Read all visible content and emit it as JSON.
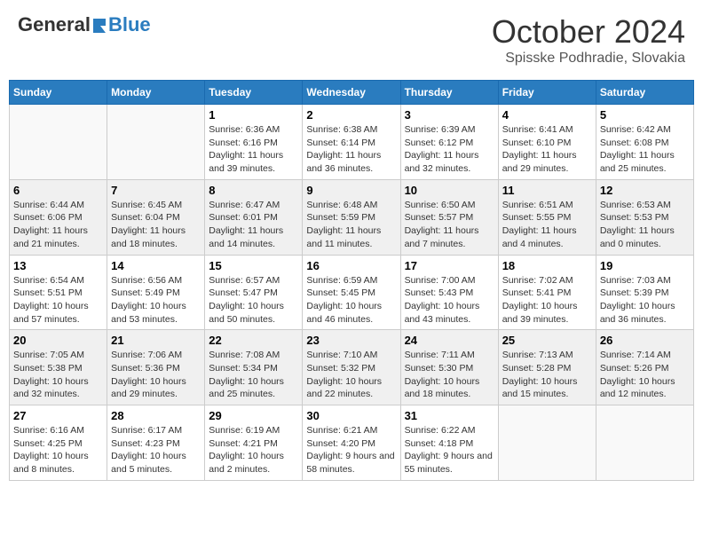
{
  "header": {
    "logo_general": "General",
    "logo_blue": "Blue",
    "month_title": "October 2024",
    "location": "Spisske Podhradie, Slovakia"
  },
  "weekdays": [
    "Sunday",
    "Monday",
    "Tuesday",
    "Wednesday",
    "Thursday",
    "Friday",
    "Saturday"
  ],
  "weeks": [
    [
      {
        "day": "",
        "info": ""
      },
      {
        "day": "",
        "info": ""
      },
      {
        "day": "1",
        "info": "Sunrise: 6:36 AM\nSunset: 6:16 PM\nDaylight: 11 hours and 39 minutes."
      },
      {
        "day": "2",
        "info": "Sunrise: 6:38 AM\nSunset: 6:14 PM\nDaylight: 11 hours and 36 minutes."
      },
      {
        "day": "3",
        "info": "Sunrise: 6:39 AM\nSunset: 6:12 PM\nDaylight: 11 hours and 32 minutes."
      },
      {
        "day": "4",
        "info": "Sunrise: 6:41 AM\nSunset: 6:10 PM\nDaylight: 11 hours and 29 minutes."
      },
      {
        "day": "5",
        "info": "Sunrise: 6:42 AM\nSunset: 6:08 PM\nDaylight: 11 hours and 25 minutes."
      }
    ],
    [
      {
        "day": "6",
        "info": "Sunrise: 6:44 AM\nSunset: 6:06 PM\nDaylight: 11 hours and 21 minutes."
      },
      {
        "day": "7",
        "info": "Sunrise: 6:45 AM\nSunset: 6:04 PM\nDaylight: 11 hours and 18 minutes."
      },
      {
        "day": "8",
        "info": "Sunrise: 6:47 AM\nSunset: 6:01 PM\nDaylight: 11 hours and 14 minutes."
      },
      {
        "day": "9",
        "info": "Sunrise: 6:48 AM\nSunset: 5:59 PM\nDaylight: 11 hours and 11 minutes."
      },
      {
        "day": "10",
        "info": "Sunrise: 6:50 AM\nSunset: 5:57 PM\nDaylight: 11 hours and 7 minutes."
      },
      {
        "day": "11",
        "info": "Sunrise: 6:51 AM\nSunset: 5:55 PM\nDaylight: 11 hours and 4 minutes."
      },
      {
        "day": "12",
        "info": "Sunrise: 6:53 AM\nSunset: 5:53 PM\nDaylight: 11 hours and 0 minutes."
      }
    ],
    [
      {
        "day": "13",
        "info": "Sunrise: 6:54 AM\nSunset: 5:51 PM\nDaylight: 10 hours and 57 minutes."
      },
      {
        "day": "14",
        "info": "Sunrise: 6:56 AM\nSunset: 5:49 PM\nDaylight: 10 hours and 53 minutes."
      },
      {
        "day": "15",
        "info": "Sunrise: 6:57 AM\nSunset: 5:47 PM\nDaylight: 10 hours and 50 minutes."
      },
      {
        "day": "16",
        "info": "Sunrise: 6:59 AM\nSunset: 5:45 PM\nDaylight: 10 hours and 46 minutes."
      },
      {
        "day": "17",
        "info": "Sunrise: 7:00 AM\nSunset: 5:43 PM\nDaylight: 10 hours and 43 minutes."
      },
      {
        "day": "18",
        "info": "Sunrise: 7:02 AM\nSunset: 5:41 PM\nDaylight: 10 hours and 39 minutes."
      },
      {
        "day": "19",
        "info": "Sunrise: 7:03 AM\nSunset: 5:39 PM\nDaylight: 10 hours and 36 minutes."
      }
    ],
    [
      {
        "day": "20",
        "info": "Sunrise: 7:05 AM\nSunset: 5:38 PM\nDaylight: 10 hours and 32 minutes."
      },
      {
        "day": "21",
        "info": "Sunrise: 7:06 AM\nSunset: 5:36 PM\nDaylight: 10 hours and 29 minutes."
      },
      {
        "day": "22",
        "info": "Sunrise: 7:08 AM\nSunset: 5:34 PM\nDaylight: 10 hours and 25 minutes."
      },
      {
        "day": "23",
        "info": "Sunrise: 7:10 AM\nSunset: 5:32 PM\nDaylight: 10 hours and 22 minutes."
      },
      {
        "day": "24",
        "info": "Sunrise: 7:11 AM\nSunset: 5:30 PM\nDaylight: 10 hours and 18 minutes."
      },
      {
        "day": "25",
        "info": "Sunrise: 7:13 AM\nSunset: 5:28 PM\nDaylight: 10 hours and 15 minutes."
      },
      {
        "day": "26",
        "info": "Sunrise: 7:14 AM\nSunset: 5:26 PM\nDaylight: 10 hours and 12 minutes."
      }
    ],
    [
      {
        "day": "27",
        "info": "Sunrise: 6:16 AM\nSunset: 4:25 PM\nDaylight: 10 hours and 8 minutes."
      },
      {
        "day": "28",
        "info": "Sunrise: 6:17 AM\nSunset: 4:23 PM\nDaylight: 10 hours and 5 minutes."
      },
      {
        "day": "29",
        "info": "Sunrise: 6:19 AM\nSunset: 4:21 PM\nDaylight: 10 hours and 2 minutes."
      },
      {
        "day": "30",
        "info": "Sunrise: 6:21 AM\nSunset: 4:20 PM\nDaylight: 9 hours and 58 minutes."
      },
      {
        "day": "31",
        "info": "Sunrise: 6:22 AM\nSunset: 4:18 PM\nDaylight: 9 hours and 55 minutes."
      },
      {
        "day": "",
        "info": ""
      },
      {
        "day": "",
        "info": ""
      }
    ]
  ]
}
